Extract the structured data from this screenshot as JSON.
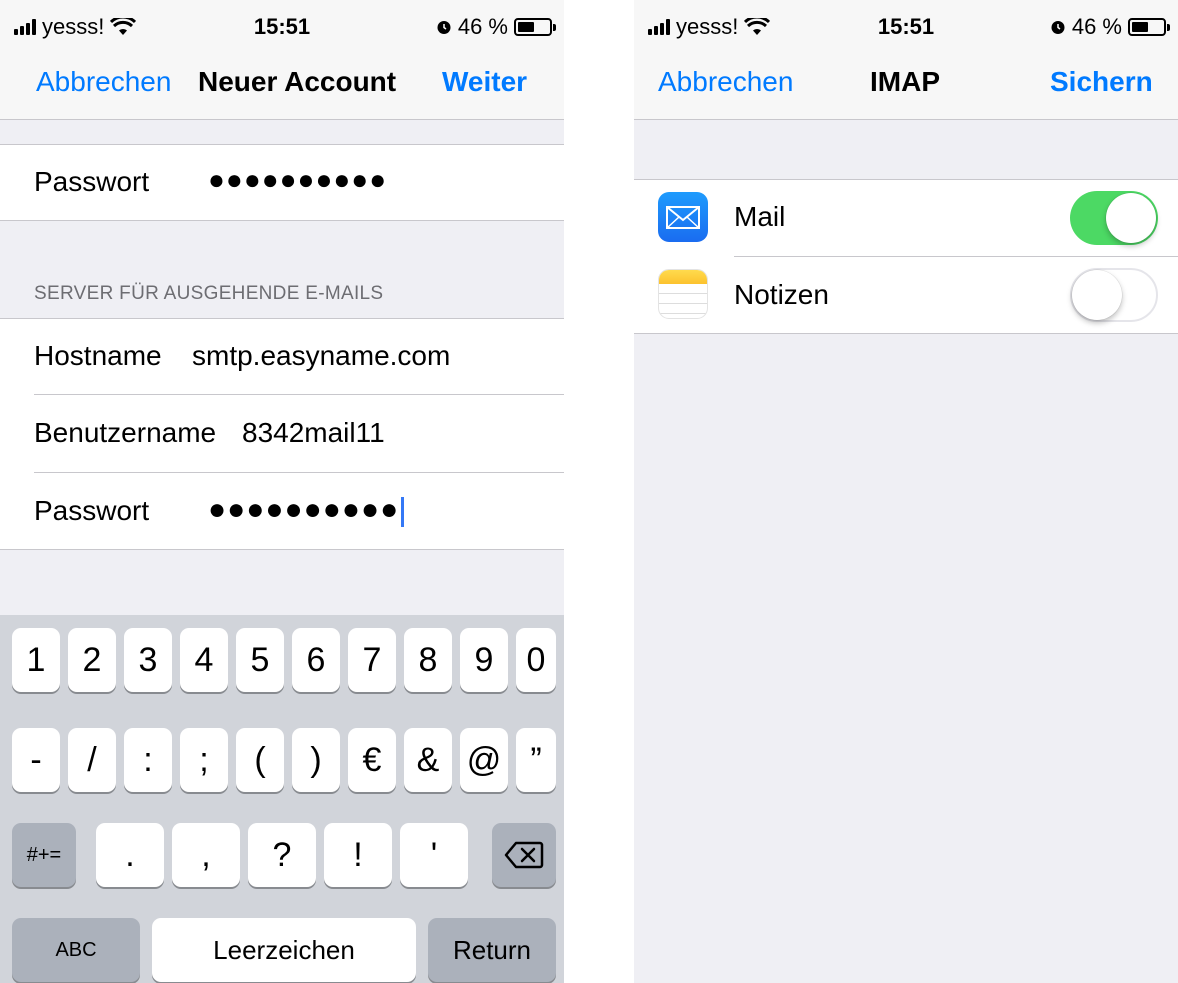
{
  "left_screen": {
    "status_bar": {
      "carrier": "yesss!",
      "time": "15:51",
      "battery_percent": "46 %"
    },
    "nav": {
      "cancel_label": "Abbrechen",
      "title": "Neuer Account",
      "next_label": "Weiter"
    },
    "incoming_password": {
      "label": "Passwort",
      "value": "●●●●●●●●●●"
    },
    "outgoing_section": {
      "header": "SERVER FÜR AUSGEHENDE E-MAILS",
      "hostname_label": "Hostname",
      "hostname_value": "smtp.easyname.com",
      "username_label": "Benutzername",
      "username_value": "8342mail11",
      "password_label": "Passwort",
      "password_value": "●●●●●●●●●●"
    },
    "keyboard": {
      "row1": [
        "1",
        "2",
        "3",
        "4",
        "5",
        "6",
        "7",
        "8",
        "9",
        "0"
      ],
      "row2": [
        "-",
        "/",
        ":",
        ";",
        "(",
        ")",
        "€",
        "&",
        "@",
        "”"
      ],
      "row3": {
        "symbols_toggle": "#+=",
        "keys": [
          ".",
          ",",
          "?",
          "!",
          "'"
        ],
        "delete_icon": "backspace-icon"
      },
      "row4": {
        "abc": "ABC",
        "space": "Leerzeichen",
        "return": "Return"
      }
    }
  },
  "right_screen": {
    "status_bar": {
      "carrier": "yesss!",
      "time": "15:51",
      "battery_percent": "46 %"
    },
    "nav": {
      "cancel_label": "Abbrechen",
      "title": "IMAP",
      "save_label": "Sichern"
    },
    "toggles": [
      {
        "label": "Mail",
        "icon": "mail-app-icon",
        "on": true
      },
      {
        "label": "Notizen",
        "icon": "notes-app-icon",
        "on": false
      }
    ]
  },
  "colors": {
    "ios_blue": "#007aff",
    "switch_green": "#4cd964",
    "cursor_blue": "#3478f6"
  }
}
